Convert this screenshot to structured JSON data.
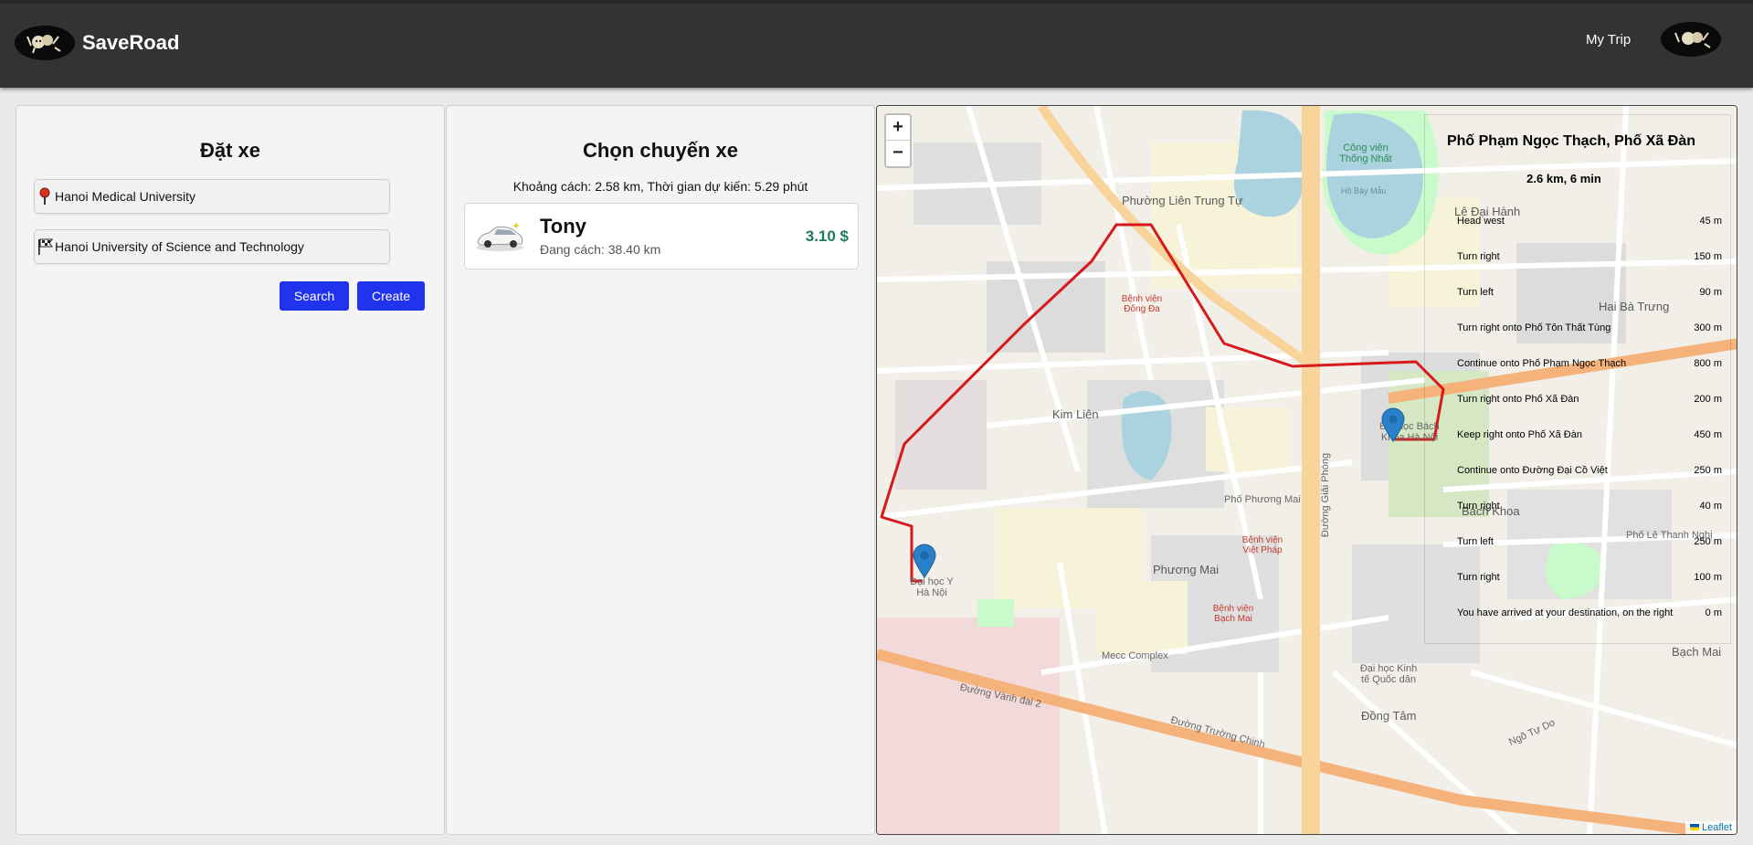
{
  "header": {
    "brand": "SaveRoad",
    "my_trip": "My Trip"
  },
  "booking": {
    "title": "Đặt xe",
    "from_value": "Hanoi Medical University",
    "to_value": "Hanoi University of Science and Technology",
    "search_label": "Search",
    "create_label": "Create"
  },
  "ride": {
    "title": "Chọn chuyến xe",
    "distance_text": "Khoảng cách: 2.58 km, Thời gian dự kiến: 5.29 phút",
    "driver": {
      "name": "Tony",
      "distance": "Đang cách: 38.40 km",
      "price": "3.10 $"
    }
  },
  "map": {
    "zoom_in": "+",
    "zoom_out": "−",
    "attribution": "Leaflet",
    "route": {
      "title": "Phố Phạm Ngọc Thạch, Phố Xã Đàn",
      "summary": "2.6 km, 6 min",
      "instructions": [
        {
          "text": "Head west",
          "distance": "45 m"
        },
        {
          "text": "Turn right",
          "distance": "150 m"
        },
        {
          "text": "Turn left",
          "distance": "90 m"
        },
        {
          "text": "Turn right onto Phố Tôn Thất Tùng",
          "distance": "300 m"
        },
        {
          "text": "Continue onto Phố Phạm Ngọc Thạch",
          "distance": "800 m"
        },
        {
          "text": "Turn right onto Phố Xã Đàn",
          "distance": "200 m"
        },
        {
          "text": "Keep right onto Phố Xã Đàn",
          "distance": "450 m"
        },
        {
          "text": "Continue onto Đường Đại Cồ Việt",
          "distance": "250 m"
        },
        {
          "text": "Turn right",
          "distance": "40 m"
        },
        {
          "text": "Turn left",
          "distance": "250 m"
        },
        {
          "text": "Turn right",
          "distance": "100 m"
        },
        {
          "text": "You have arrived at your destination, on the right",
          "distance": "0 m"
        }
      ]
    },
    "labels": [
      "Phường Liên Trung Tự",
      "Kim Liên",
      "Phương Mai",
      "Bách Khoa",
      "Đồng Tâm",
      "Bạch Mai",
      "Hai Bà Trưng",
      "Lê Đại Hành",
      "Công viên Thống Nhất",
      "Hồ Bảy Mẫu",
      "Đại học Bách Khoa Hà Nội",
      "Đại học Y Hà Nội",
      "Bệnh viện Đống Đa",
      "Bệnh viện Bạch Mai",
      "Bệnh viện Việt Pháp",
      "Đại học Kinh tế Quốc dân",
      "Đường Vành đai 2",
      "Phố Phương Mai",
      "Đường Giải Phóng",
      "Phố Lê Thanh Nghị",
      "Ngõ Tự Do",
      "Mecc Complex",
      "Đường Trường Chinh"
    ],
    "colors": {
      "route": "#d7191c",
      "marker": "#2a81cb",
      "major_road": "#f5b27a",
      "water": "#aad3df",
      "park": "#c8facc"
    }
  }
}
